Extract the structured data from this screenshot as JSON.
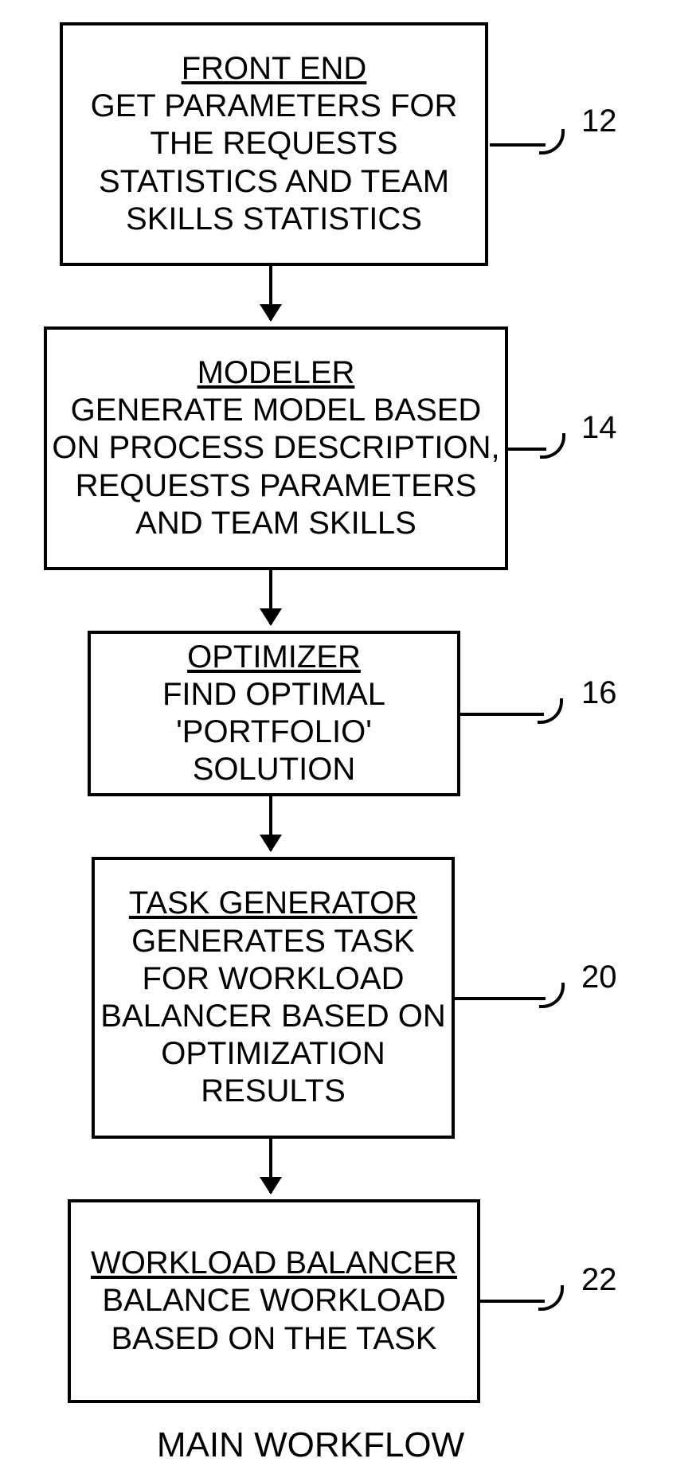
{
  "boxes": {
    "b1": {
      "heading": "FRONT END",
      "body": "GET PARAMETERS FOR THE REQUESTS STATISTICS AND TEAM SKILLS STATISTICS"
    },
    "b2": {
      "heading": "MODELER",
      "body": "GENERATE MODEL BASED ON PROCESS DESCRIPTION, REQUESTS PARAMETERS AND TEAM SKILLS"
    },
    "b3": {
      "heading": "OPTIMIZER",
      "body": "FIND OPTIMAL 'PORTFOLIO' SOLUTION"
    },
    "b4": {
      "heading": "TASK GENERATOR",
      "body": "GENERATES TASK FOR WORKLOAD BALANCER BASED ON OPTIMIZATION RESULTS"
    },
    "b5": {
      "heading": "WORKLOAD BALANCER",
      "body": "BALANCE WORKLOAD BASED ON THE TASK"
    }
  },
  "labels": {
    "l1": "12",
    "l2": "14",
    "l3": "16",
    "l4": "20",
    "l5": "22"
  },
  "caption": "MAIN WORKFLOW"
}
